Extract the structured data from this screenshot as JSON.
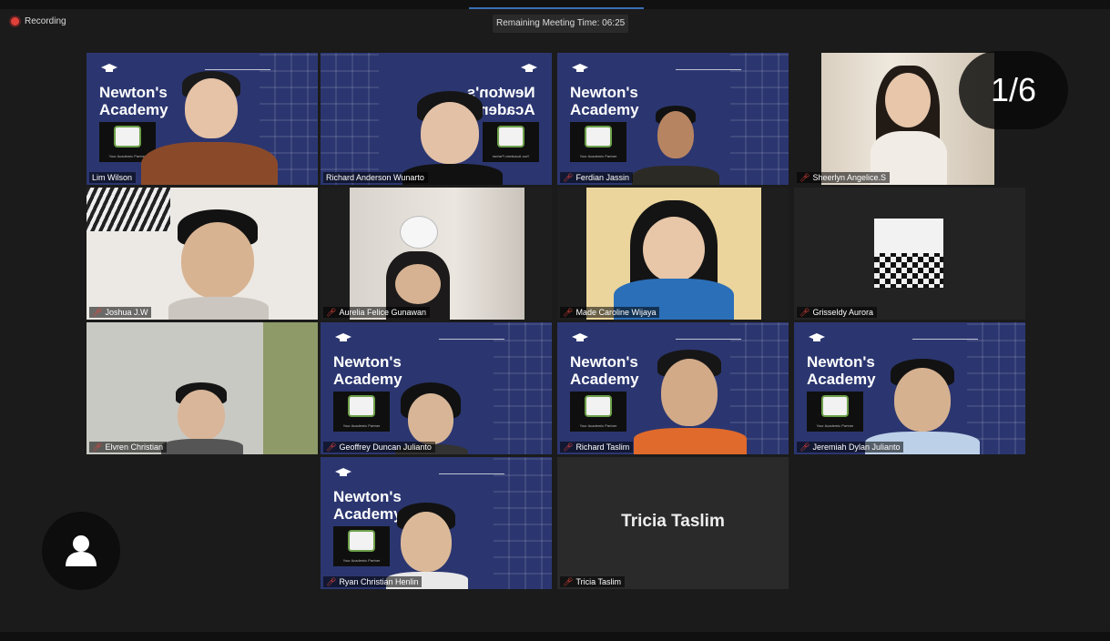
{
  "recording": {
    "label": "Recording"
  },
  "timer": {
    "label": "Remaining Meeting Time: 06:25"
  },
  "pager": {
    "label": "1/6"
  },
  "brand": {
    "line1": "Newton's",
    "line2": "Academy"
  },
  "participants": [
    {
      "name": "Lim Wilson"
    },
    {
      "name": "Richard Anderson Wunarto"
    },
    {
      "name": "Ferdian Jassin"
    },
    {
      "name": "Sheerlyn Angelice.S"
    },
    {
      "name": "Joshua J.W"
    },
    {
      "name": "Aurelia Felice Gunawan"
    },
    {
      "name": "Made Caroline Wijaya"
    },
    {
      "name": "Grisseldy Aurora"
    },
    {
      "name": "Elvren Christian"
    },
    {
      "name": "Geoffrey Duncan Julianto"
    },
    {
      "name": "Richard Taslim"
    },
    {
      "name": "Jeremiah Dylan Julianto"
    },
    {
      "name": "Ryan Christian Henlin"
    },
    {
      "name": "Tricia Taslim"
    }
  ],
  "colors": {
    "active_border": "#d3e36a",
    "muted_mic": "#e5443a",
    "academy_bg": "#2b3670",
    "recording_dot": "#e0403a"
  },
  "icons": {
    "mic": "muted-mic-icon",
    "avatar": "user-avatar-icon",
    "cap": "graduation-cap-icon"
  }
}
